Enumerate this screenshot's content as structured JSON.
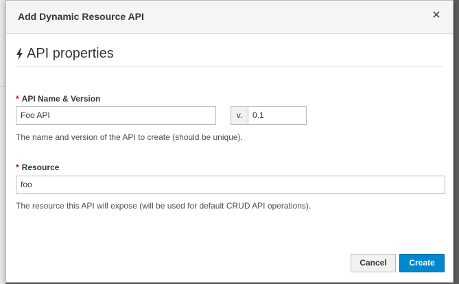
{
  "dialog": {
    "title": "Add Dynamic Resource API",
    "close_icon": "close-icon"
  },
  "section": {
    "icon": "bolt-icon",
    "title": "API properties"
  },
  "api_name": {
    "required_mark": "*",
    "label": "API Name & Version",
    "name_value": "Foo API",
    "version_addon": "v.",
    "version_value": "0.1",
    "help": "The name and version of the API to create (should be unique)."
  },
  "resource": {
    "required_mark": "*",
    "label": "Resource",
    "value": "foo",
    "help": "The resource this API will expose (will be used for default CRUD API operations)."
  },
  "footer": {
    "cancel_label": "Cancel",
    "create_label": "Create"
  },
  "colors": {
    "primary": "#0088ce",
    "required": "#cc0000",
    "header_bg": "#f5f5f5"
  }
}
